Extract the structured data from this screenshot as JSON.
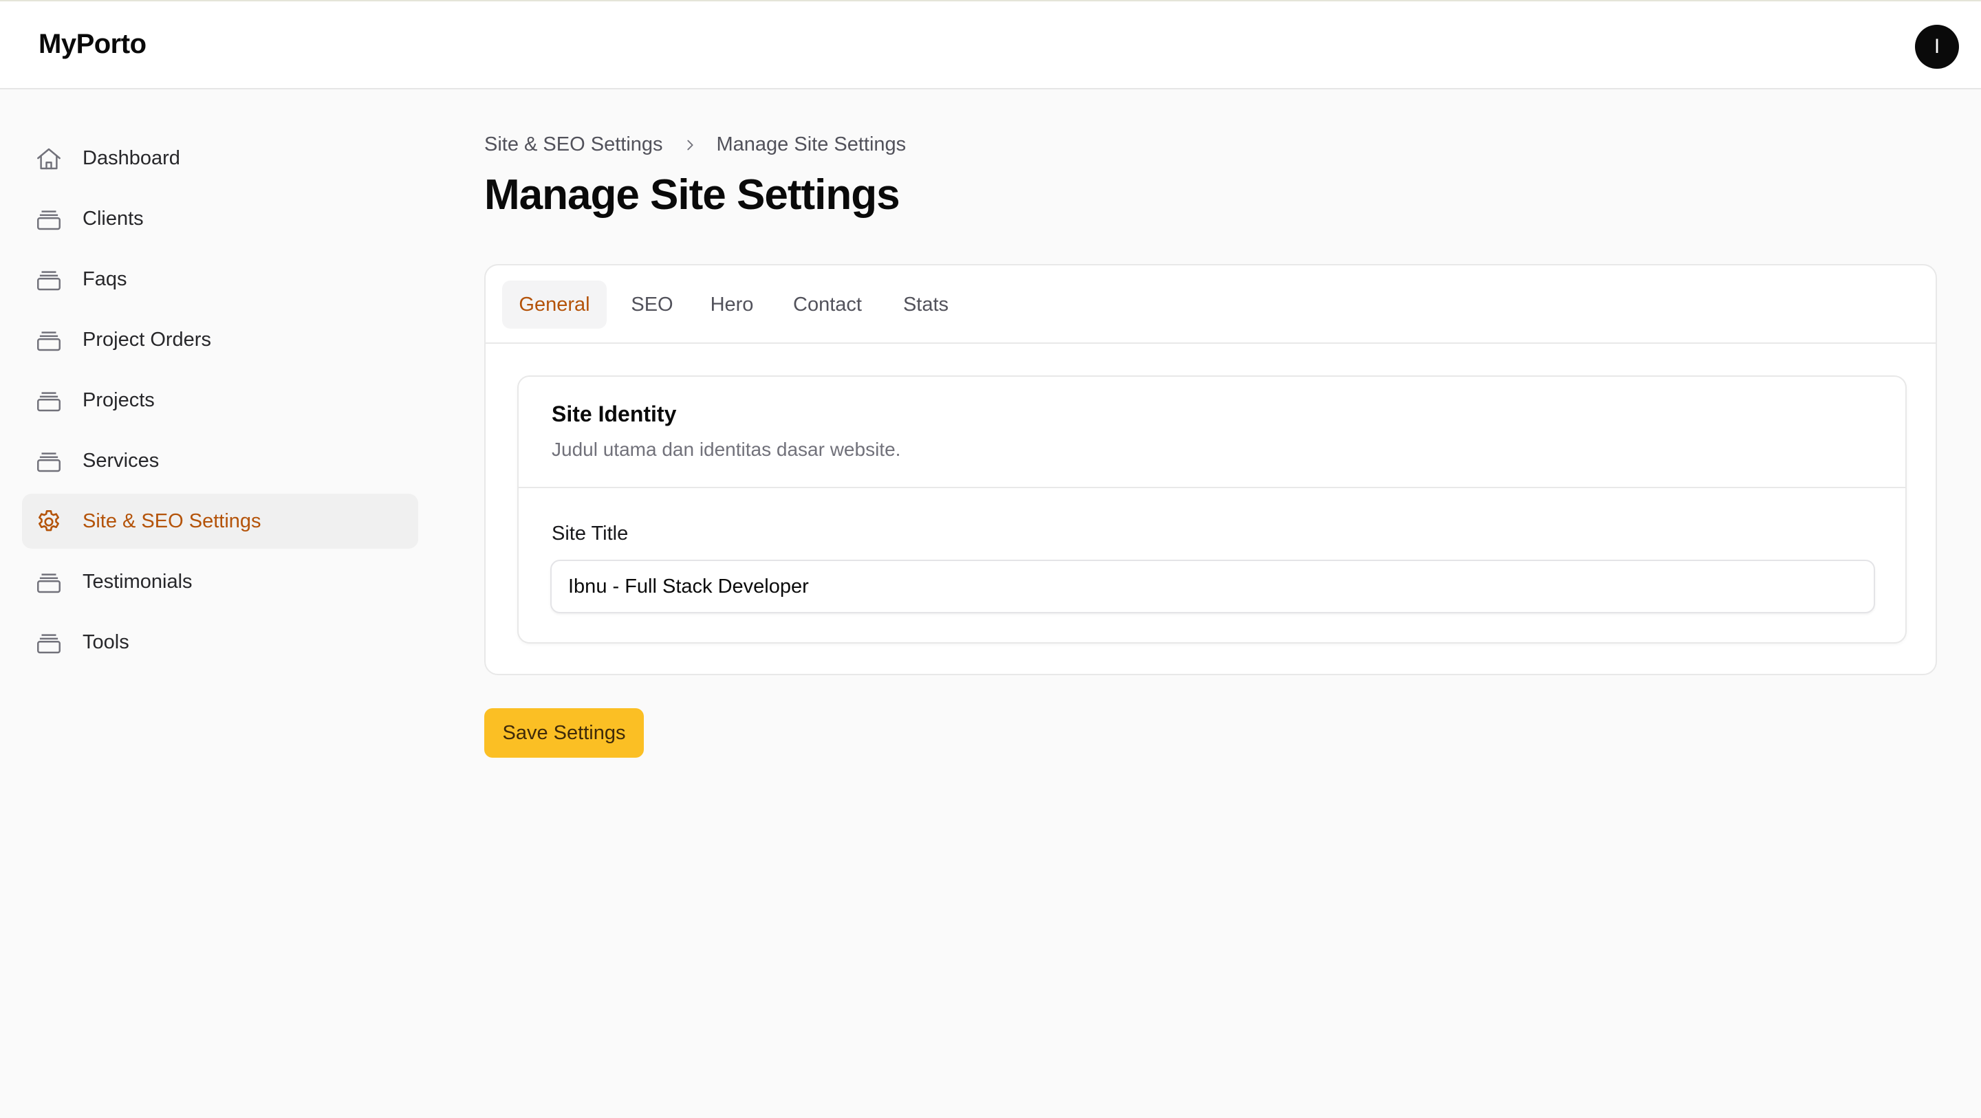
{
  "app": {
    "brand": "MyPorto",
    "avatar_initial": "I"
  },
  "sidebar": {
    "items": [
      {
        "label": "Dashboard",
        "icon": "home-icon",
        "active": false
      },
      {
        "label": "Clients",
        "icon": "stack-icon",
        "active": false
      },
      {
        "label": "Faqs",
        "icon": "stack-icon",
        "active": false
      },
      {
        "label": "Project Orders",
        "icon": "stack-icon",
        "active": false
      },
      {
        "label": "Projects",
        "icon": "stack-icon",
        "active": false
      },
      {
        "label": "Services",
        "icon": "stack-icon",
        "active": false
      },
      {
        "label": "Site & SEO Settings",
        "icon": "gear-icon",
        "active": true
      },
      {
        "label": "Testimonials",
        "icon": "stack-icon",
        "active": false
      },
      {
        "label": "Tools",
        "icon": "stack-icon",
        "active": false
      }
    ]
  },
  "breadcrumb": {
    "items": [
      "Site & SEO Settings",
      "Manage Site Settings"
    ]
  },
  "page": {
    "title": "Manage Site Settings"
  },
  "tabs": [
    {
      "label": "General",
      "active": true
    },
    {
      "label": "SEO",
      "active": false
    },
    {
      "label": "Hero",
      "active": false
    },
    {
      "label": "Contact",
      "active": false
    },
    {
      "label": "Stats",
      "active": false
    }
  ],
  "section": {
    "title": "Site Identity",
    "description": "Judul utama dan identitas dasar website.",
    "field_label": "Site Title",
    "field_value": "Ibnu - Full Stack Developer"
  },
  "actions": {
    "save_label": "Save Settings"
  },
  "colors": {
    "accent": "#b45309",
    "button_bg": "#fbbf24",
    "page_bg": "#fafafa"
  }
}
